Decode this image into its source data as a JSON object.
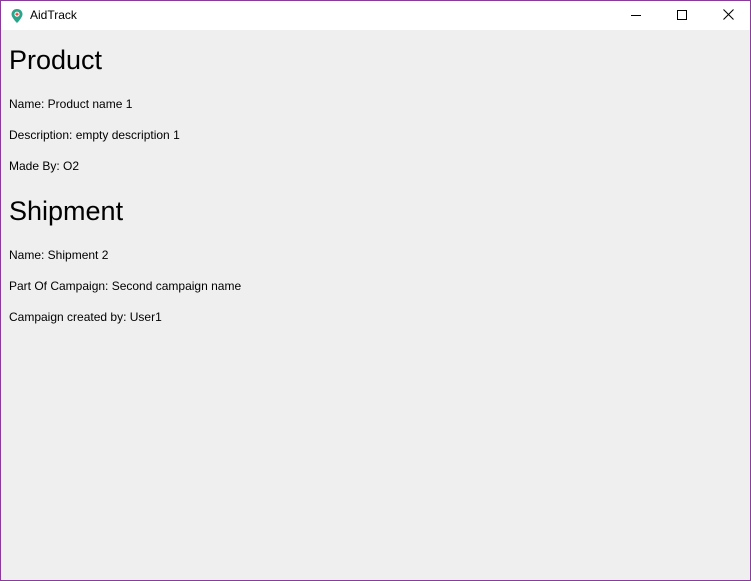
{
  "window": {
    "title": "AidTrack",
    "accent_color": "#8a3b9a"
  },
  "icons": {
    "app": "map-pin-icon",
    "minimize": "minimize-icon",
    "maximize": "maximize-icon",
    "close": "close-icon"
  },
  "product": {
    "heading": "Product",
    "name": "Name: Product name 1",
    "description": "Description: empty description 1",
    "made_by": "Made By: O2"
  },
  "shipment": {
    "heading": "Shipment",
    "name": "Name: Shipment 2",
    "campaign": "Part Of Campaign: Second campaign name",
    "created_by": "Campaign created by: User1"
  }
}
